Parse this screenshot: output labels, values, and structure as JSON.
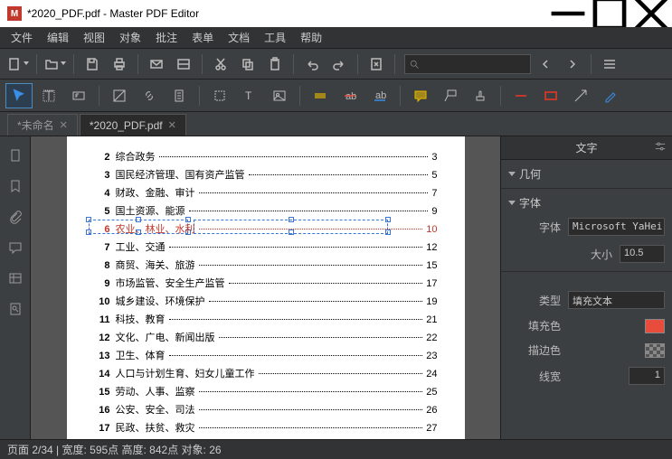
{
  "window": {
    "title": "*2020_PDF.pdf - Master PDF Editor"
  },
  "menu": [
    "文件",
    "编辑",
    "视图",
    "对象",
    "批注",
    "表单",
    "文档",
    "工具",
    "帮助"
  ],
  "tabs": [
    {
      "label": "*未命名",
      "active": false
    },
    {
      "label": "*2020_PDF.pdf",
      "active": true
    }
  ],
  "toc": [
    {
      "n": "2",
      "t": "综合政务",
      "p": "3"
    },
    {
      "n": "3",
      "t": "国民经济管理、国有资产监管",
      "p": "5"
    },
    {
      "n": "4",
      "t": "财政、金融、审计",
      "p": "7"
    },
    {
      "n": "5",
      "t": "国土资源、能源",
      "p": "9"
    },
    {
      "n": "6",
      "t": "农业、林业、水利",
      "p": "10",
      "sel": true
    },
    {
      "n": "7",
      "t": "工业、交通",
      "p": "12"
    },
    {
      "n": "8",
      "t": "商贸、海关、旅游",
      "p": "15"
    },
    {
      "n": "9",
      "t": "市场监管、安全生产监管",
      "p": "17"
    },
    {
      "n": "10",
      "t": "城乡建设、环境保护",
      "p": "19"
    },
    {
      "n": "11",
      "t": "科技、教育",
      "p": "21"
    },
    {
      "n": "12",
      "t": "文化、广电、新闻出版",
      "p": "22"
    },
    {
      "n": "13",
      "t": "卫生、体育",
      "p": "23"
    },
    {
      "n": "14",
      "t": "人口与计划生育、妇女儿童工作",
      "p": "24"
    },
    {
      "n": "15",
      "t": "劳动、人事、监察",
      "p": "25"
    },
    {
      "n": "16",
      "t": "公安、安全、司法",
      "p": "26"
    },
    {
      "n": "17",
      "t": "民政、扶贫、救灾",
      "p": "27"
    }
  ],
  "props": {
    "panelTitle": "文字",
    "geomLabel": "几何",
    "fontLabel": "字体",
    "fontFieldLabel": "字体",
    "fontValue": "Microsoft YaHei",
    "sizeLabel": "大小",
    "sizeValue": "10.5",
    "typeLabel": "类型",
    "typeValue": "填充文本",
    "fillLabel": "填充色",
    "fillColor": "#e74c3c",
    "strokeLabel": "描边色",
    "strokeColor": "transparent",
    "lwLabel": "线宽",
    "lwValue": "1"
  },
  "status": {
    "text": "页面 2/34 | 宽度: 595点 高度: 842点 对象: 26"
  }
}
